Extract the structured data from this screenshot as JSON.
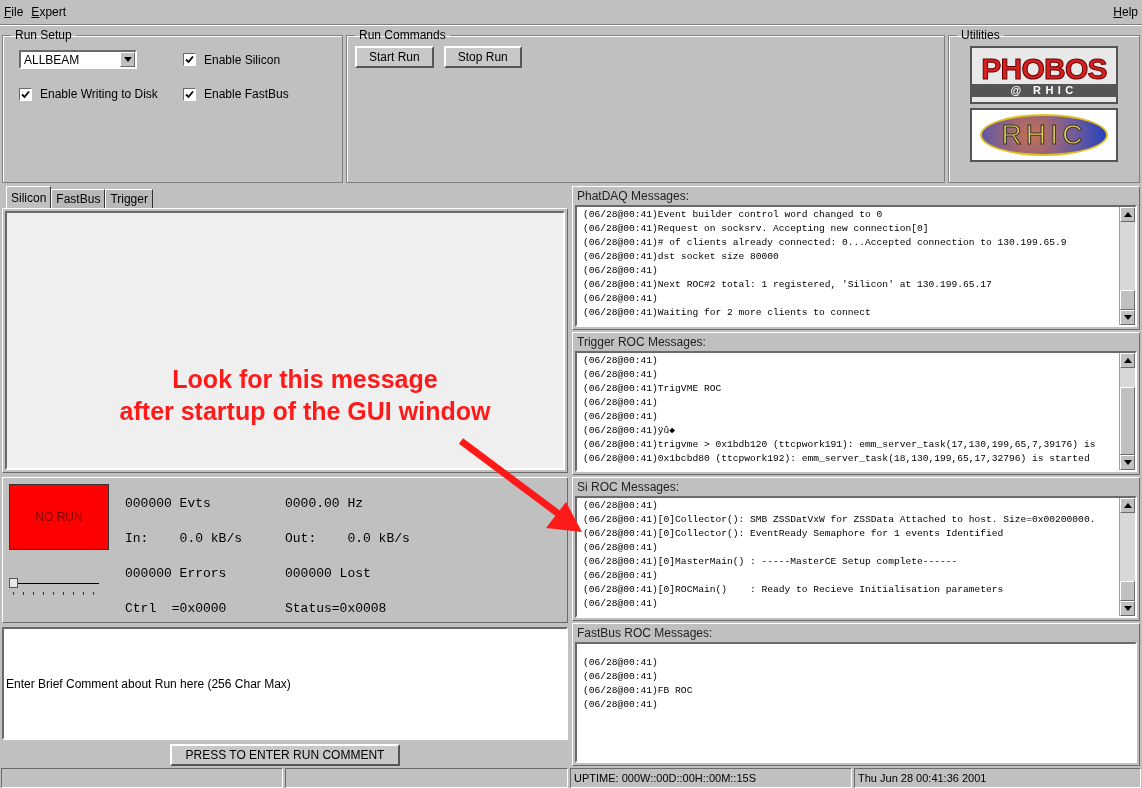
{
  "menu": [
    {
      "label": "File"
    },
    {
      "label": "Expert"
    }
  ],
  "help_menu": "Help",
  "run_setup": {
    "title": "Run Setup",
    "mode": "ALLBEAM",
    "checkboxes": [
      {
        "label": "Enable Silicon",
        "checked": true
      },
      {
        "label": "Enable Writing to Disk",
        "checked": true
      },
      {
        "label": "Enable FastBus",
        "checked": true
      }
    ]
  },
  "run_commands": {
    "title": "Run Commands",
    "buttons": [
      "Start Run",
      "Stop Run"
    ]
  },
  "utilities": {
    "title": "Utilities",
    "logos": [
      {
        "kind": "phobos",
        "text": "PHOBOS",
        "subtext": "@ RHIC"
      },
      {
        "kind": "rhic",
        "text": "RHIC"
      }
    ]
  },
  "tabs": [
    {
      "label": "Silicon",
      "selected": true
    },
    {
      "label": "FastBus",
      "selected": false
    },
    {
      "label": "Trigger",
      "selected": false
    }
  ],
  "annotation": {
    "lines": [
      "Look for this message",
      "after startup of the GUI window"
    ]
  },
  "run_status": {
    "label": "NO RUN",
    "running": false,
    "slider": {
      "level": 0
    },
    "stats": [
      "000000 Evts",
      "0000.00 Hz",
      "In:    0.0 kB/s",
      "Out:    0.0 kB/s",
      "000000 Errors",
      "000000 Lost",
      "Ctrl  =0x0000",
      "Status=0x0008"
    ]
  },
  "comment": {
    "value": "Enter Brief Comment about Run here (256 Char Max)",
    "button": "PRESS TO ENTER RUN COMMENT"
  },
  "message_panels": [
    {
      "title": "PhatDAQ Messages:",
      "scrollbar": true,
      "lines": [
        "(06/28@00:41)Event builder control word changed to 0",
        "(06/28@00:41)Request on socksrv. Accepting new connection[0]",
        "(06/28@00:41)# of clients already connected: 0...Accepted connection to 130.199.65.9",
        "(06/28@00:41)dst socket size 80000",
        "(06/28@00:41)",
        "(06/28@00:41)Next ROC#2 total: 1 registered, 'Silicon' at 130.199.65.17",
        "(06/28@00:41)",
        "(06/28@00:41)Waiting for 2 more clients to connect"
      ]
    },
    {
      "title": "Trigger ROC Messages:",
      "scrollbar": true,
      "lines": [
        "(06/28@00:41)",
        "(06/28@00:41)",
        "(06/28@00:41)TrigVME ROC",
        "(06/28@00:41)",
        "(06/28@00:41)",
        "(06/28@00:41)ÿû◆",
        "(06/28@00:41)trigvme > 0x1bdb120 (ttcpwork191): emm_server_task(17,130,199,65,7,39176) is",
        "(06/28@00:41)0x1bcbd80 (ttcpwork192): emm_server_task(18,130,199,65,17,32796) is started"
      ]
    },
    {
      "title": "Si ROC Messages:",
      "scrollbar": true,
      "lines": [
        "(06/28@00:41)",
        "(06/28@00:41)[0]Collector(): SMB ZSSDatVxW for ZSSData Attached to host. Size=0x00200000.",
        "(06/28@00:41)[0]Collector(): EventReady Semaphore for 1 events Identified",
        "(06/28@00:41)",
        "(06/28@00:41)[0]MasterMain() : -----MasterCE Setup complete------",
        "(06/28@00:41)",
        "(06/28@00:41)[0]ROCMain()    : Ready to Recieve Initialisation parameters",
        "(06/28@00:41)"
      ]
    },
    {
      "title": "FastBus ROC Messages:",
      "scrollbar": false,
      "lines": [
        "(06/28@00:41)",
        "(06/28@00:41)",
        "(06/28@00:41)FB ROC",
        "(06/28@00:41)"
      ]
    }
  ],
  "status_bar": {
    "uptime": "UPTIME: 000W::00D::00H::00M::15S",
    "date": "Thu Jun 28 00:41:36 2001"
  }
}
